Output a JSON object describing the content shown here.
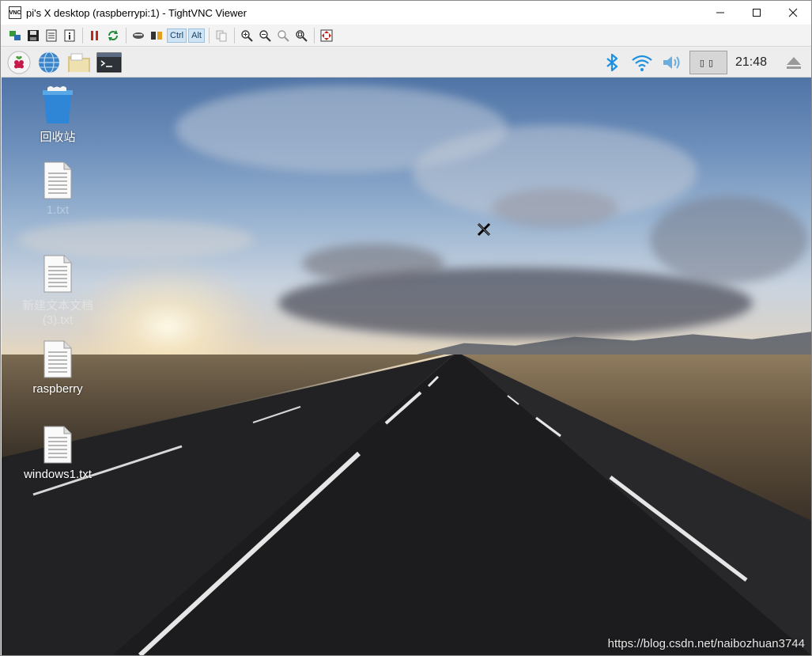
{
  "window": {
    "title": "pi's X desktop (raspberrypi:1) - TightVNC Viewer",
    "app_icon_text": "VNC",
    "controls": {
      "minimize": "—",
      "maximize": "☐",
      "close": "✕"
    }
  },
  "vnc_toolbar": {
    "buttons": [
      "new-connection-icon",
      "save-icon",
      "options-icon",
      "info-icon",
      "pause-icon",
      "refresh-icon",
      "ctrl-alt-del-icon",
      "ctrl-esc-icon",
      "copy-icon",
      "zoom-in-icon",
      "zoom-out-icon",
      "zoom-100-icon",
      "zoom-fit-icon",
      "fullscreen-icon"
    ],
    "ctrl_label": "Ctrl",
    "alt_label": "Alt"
  },
  "panel": {
    "icons": [
      "raspberry-menu-icon",
      "web-browser-icon",
      "file-manager-icon",
      "terminal-icon"
    ],
    "tray_icons": [
      "bluetooth-icon",
      "wifi-icon",
      "volume-icon",
      "cpu-monitor",
      "eject-icon"
    ],
    "cpu_text": "▯▯",
    "clock": "21:48"
  },
  "desktop": {
    "icons": [
      {
        "label": "回收站",
        "type": "trash",
        "faint": false
      },
      {
        "label": "1.txt",
        "type": "text-file",
        "faint": true
      },
      {
        "label": "新建文本文档\n(3).txt",
        "type": "text-file",
        "faint": true
      },
      {
        "label": "raspberry",
        "type": "text-file",
        "faint": false
      },
      {
        "label": "windows1.txt",
        "type": "text-file",
        "faint": false
      }
    ],
    "watermark": "https://blog.csdn.net/naibozhuan3744"
  },
  "colors": {
    "sky_top": "#4f74a6",
    "road": "#1e1e1f",
    "panel_bg": "#ededed",
    "bluetooth_blue": "#1e90e0",
    "raspberry_red": "#c51a4a"
  }
}
